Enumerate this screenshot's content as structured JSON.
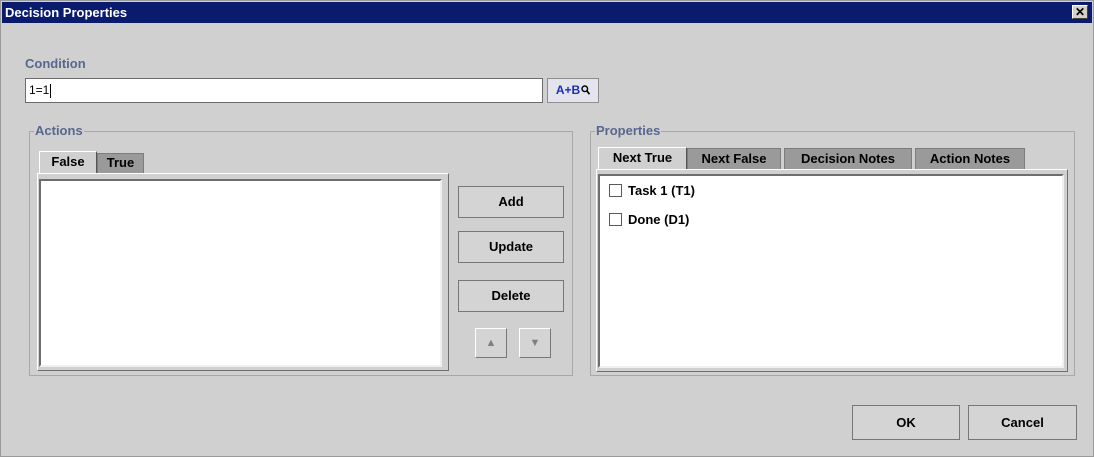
{
  "window": {
    "title": "Decision Properties",
    "close_symbol": "✕"
  },
  "condition": {
    "label": "Condition",
    "value": "1=1",
    "expr_button_label": "A+B",
    "expr_button_icon": "magnifier-icon"
  },
  "actions": {
    "label": "Actions",
    "tabs": [
      {
        "label": "False",
        "active": true
      },
      {
        "label": "True",
        "active": false
      }
    ],
    "items": [],
    "buttons": {
      "add": "Add",
      "update": "Update",
      "delete": "Delete"
    },
    "move_up_symbol": "▲",
    "move_down_symbol": "▼"
  },
  "properties": {
    "label": "Properties",
    "tabs": [
      {
        "label": "Next True",
        "active": true
      },
      {
        "label": "Next False",
        "active": false
      },
      {
        "label": "Decision Notes",
        "active": false
      },
      {
        "label": "Action Notes",
        "active": false
      }
    ],
    "items": [
      {
        "label": "Task 1 (T1)",
        "checked": false
      },
      {
        "label": "Done (D1)",
        "checked": false
      }
    ]
  },
  "footer": {
    "ok_label": "OK",
    "cancel_label": "Cancel"
  }
}
